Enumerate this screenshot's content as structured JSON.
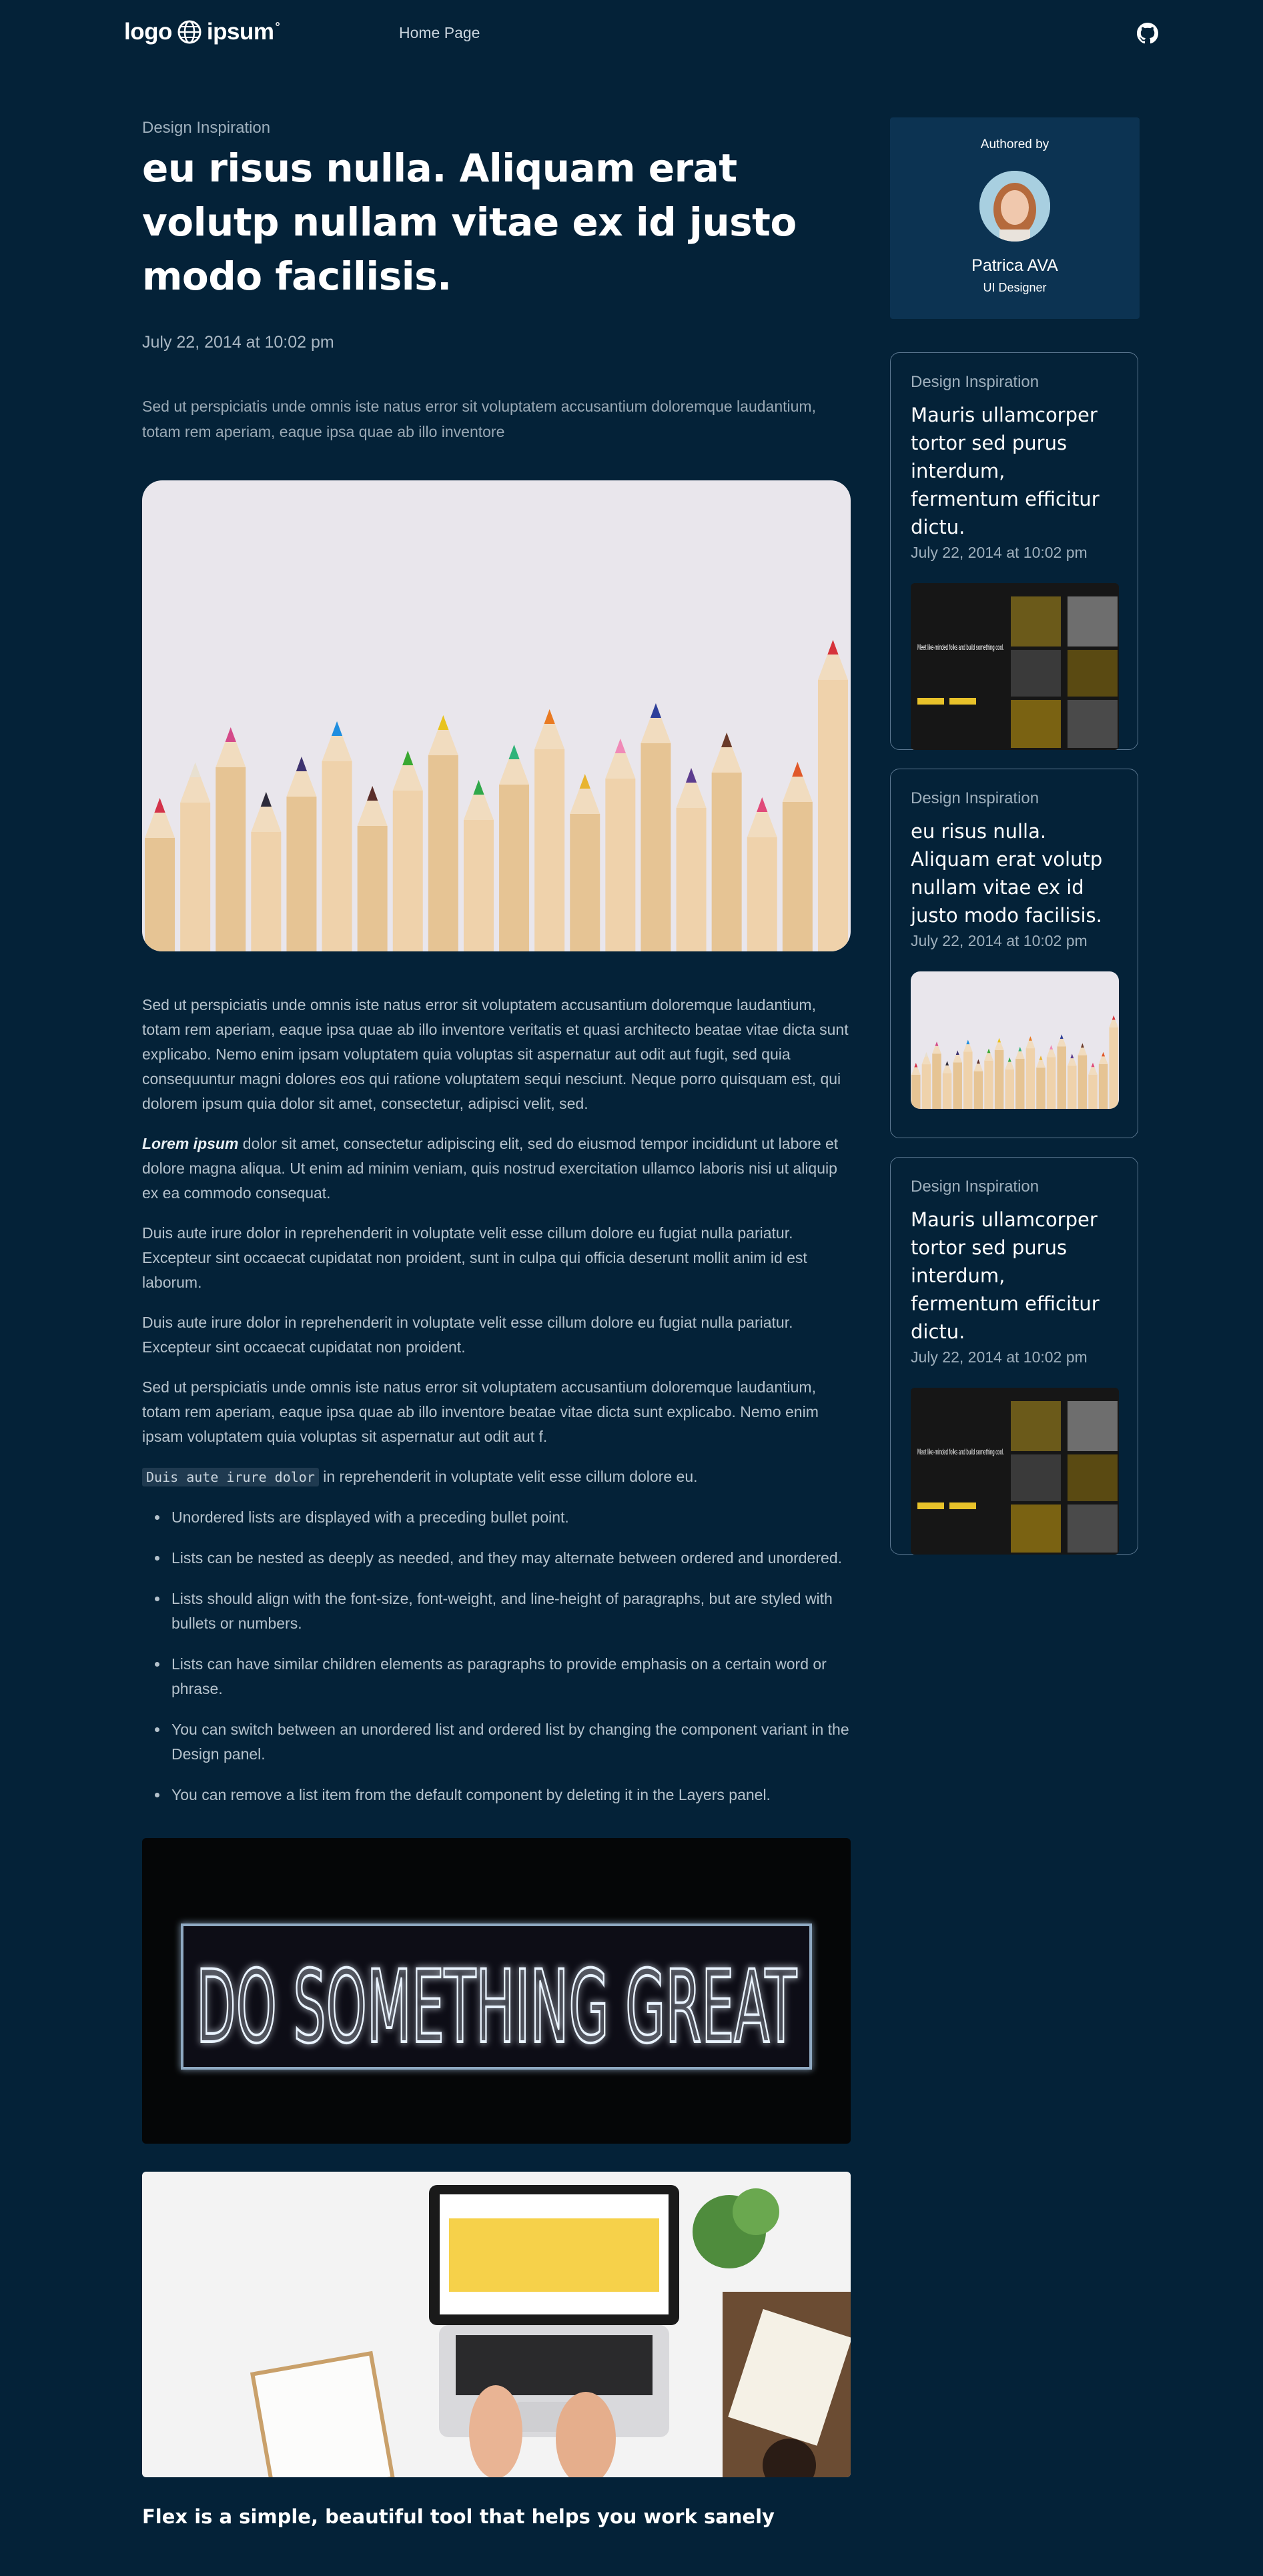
{
  "header": {
    "logo_text": "logo",
    "logo_text2": "ipsum",
    "logo_tm": "°",
    "nav_home": "Home Page",
    "github_icon": "github-icon"
  },
  "article": {
    "category": "Design Inspiration",
    "title": "eu risus nulla. Aliquam erat volutp nullam vitae ex id justo modo facilisis.",
    "date": "July 22, 2014 at 10:02 pm",
    "lead": "Sed ut perspiciatis unde omnis iste natus error sit voluptatem accusantium doloremque laudantium, totam rem aperiam, eaque ipsa quae ab illo inventore",
    "p1": "Sed ut perspiciatis unde omnis iste natus error sit voluptatem accusantium doloremque laudantium, totam rem aperiam, eaque ipsa quae ab illo inventore veritatis et quasi architecto beatae vitae dicta sunt explicabo. Nemo enim ipsam voluptatem quia voluptas sit aspernatur aut odit aut fugit, sed quia consequuntur magni dolores eos qui ratione voluptatem sequi nesciunt. Neque porro quisquam est, qui dolorem ipsum quia dolor sit amet, consectetur, adipisci velit, sed.",
    "p2_bold": "Lorem ipsum",
    "p2_rest": " dolor sit amet, consectetur adipiscing elit, sed do eiusmod tempor incididunt ut labore et dolore magna aliqua. Ut enim ad minim veniam, quis nostrud exercitation ullamco laboris nisi ut aliquip ex ea commodo consequat.",
    "p3": "Duis aute irure dolor in reprehenderit in voluptate velit esse cillum dolore eu fugiat nulla pariatur. Excepteur sint occaecat cupidatat non proident, sunt in culpa qui officia deserunt mollit anim id est laborum.",
    "p4": "Duis aute irure dolor in reprehenderit in voluptate velit esse cillum dolore eu fugiat nulla pariatur. Excepteur sint occaecat cupidatat non proident.",
    "p5": "Sed ut perspiciatis unde omnis iste natus error sit voluptatem accusantium doloremque laudantium, totam rem aperiam, eaque ipsa quae ab illo inventore beatae vitae dicta sunt explicabo. Nemo enim ipsam voluptatem quia voluptas sit aspernatur aut odit aut f.",
    "p6_code": "Duis aute irure dolor",
    "p6_rest": " in reprehenderit in voluptate velit esse cillum dolore eu.",
    "bullets": [
      "Unordered lists are displayed with a preceding bullet point.",
      "Lists can be nested as deeply as needed, and they may alternate between ordered and unordered.",
      "Lists should align with the font-size, font-weight, and line-height of paragraphs, but are styled with bullets or numbers.",
      "Lists can have similar children elements as paragraphs to provide emphasis on a certain word or phrase.",
      "You can switch between an unordered list and ordered list by changing the component variant in the Design panel.",
      "You can remove a list item from the default component by deleting it in the Layers panel."
    ],
    "neon_text": "DO SOMETHING GREAT",
    "section_heading": "Flex is a simple, beautiful tool that helps you work sanely"
  },
  "author": {
    "label": "Authored by",
    "name": "Patrica AVA",
    "role": "UI Designer"
  },
  "sidebar": {
    "cards": [
      {
        "category": "Design Inspiration",
        "title": "Mauris ullamcorper tortor sed purus interdum, fermentum efficitur dictu.",
        "date": "July 22, 2014 at 10:02 pm",
        "thumb_text": "Meet like-minded folks and build something cool."
      },
      {
        "category": "Design Inspiration",
        "title": "eu risus nulla. Aliquam erat volutp nullam vitae ex id justo modo facilisis.",
        "date": "July 22, 2014 at 10:02 pm"
      },
      {
        "category": "Design Inspiration",
        "title": "Mauris ullamcorper tortor sed purus interdum, fermentum efficitur dictu.",
        "date": "July 22, 2014 at 10:02 pm",
        "thumb_text": "Meet like-minded folks and build something cool."
      }
    ]
  },
  "colors": {
    "page_bg": "#042238",
    "author_card_bg": "#0c3352",
    "card_border": "#5b7790"
  }
}
